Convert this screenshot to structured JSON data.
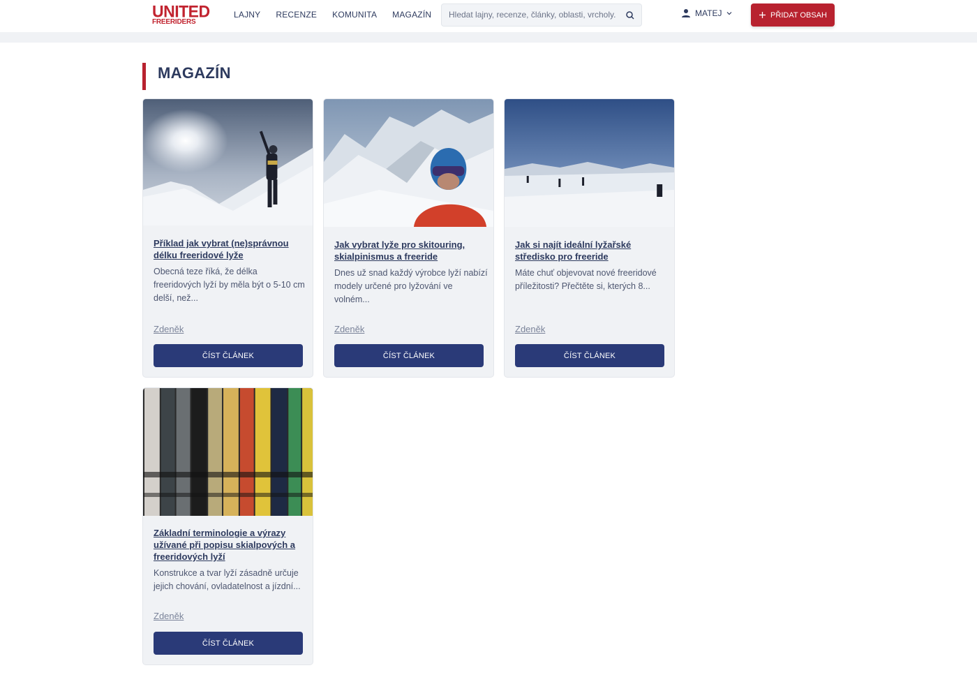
{
  "header": {
    "logo_line1": "UNITED",
    "logo_line2": "FREERIDERS",
    "nav": [
      "LAJNY",
      "RECENZE",
      "KOMUNITA",
      "MAGAZÍN"
    ],
    "search_placeholder": "Hledat lajny, recenze, články, oblasti, vrcholy...",
    "user_label": "MATEJ",
    "add_button_label": "PŘIDAT OBSAH"
  },
  "page": {
    "title": "MAGAZÍN"
  },
  "articles": [
    {
      "title": "Příklad jak vybrat (ne)správnou délku freeridové lyže",
      "excerpt": "Obecná teze říká, že délka freeridových lyží by měla být o 5-10 cm delší, než...",
      "author": "Zdeněk",
      "button": "ČÍST ČLÁNEK"
    },
    {
      "title": "Jak vybrat lyže pro skitouring, skialpinismus a freeride",
      "excerpt": "Dnes už snad každý výrobce lyží nabízí modely určené pro lyžování ve volném...",
      "author": "Zdeněk",
      "button": "ČÍST ČLÁNEK"
    },
    {
      "title": "Jak si najít ideální lyžařské středisko pro freeride",
      "excerpt": "Máte chuť objevovat nové freeridové příležitosti? Přečtěte si, kterých 8...",
      "author": "Zdeněk",
      "button": "ČÍST ČLÁNEK"
    },
    {
      "title": "Základní terminologie a výrazy užívané při popisu skialpových a freeridových lyží",
      "excerpt": "Konstrukce a tvar lyží zásadně určuje jejich chování, ovladatelnost a jízdní...",
      "author": "Zdeněk",
      "button": "ČÍST ČLÁNEK"
    }
  ],
  "colors": {
    "brand_red": "#b8222f",
    "navy": "#2a3a78",
    "text": "#2d3a5e"
  }
}
